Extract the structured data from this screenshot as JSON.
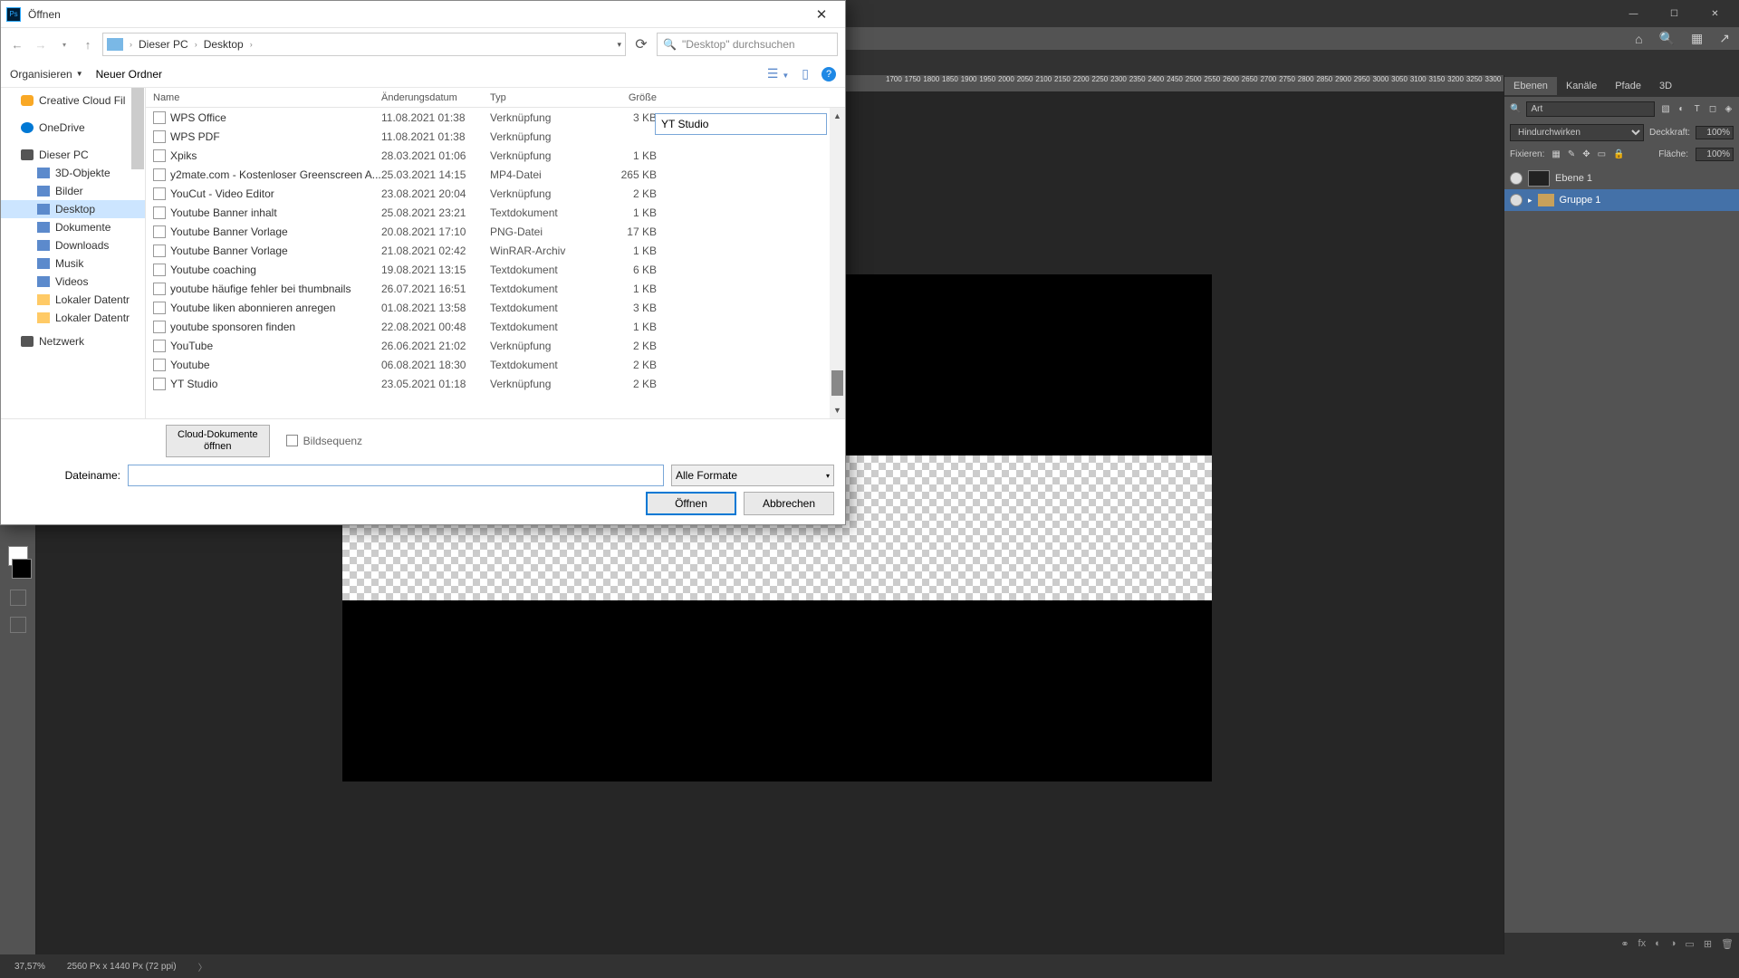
{
  "window": {
    "title": "Öffnen"
  },
  "breadcrumb": {
    "pc": "Dieser PC",
    "desktop": "Desktop"
  },
  "search": {
    "placeholder": "\"Desktop\" durchsuchen"
  },
  "toolbar": {
    "organize": "Organisieren",
    "newfolder": "Neuer Ordner"
  },
  "tree": {
    "ccfiles": "Creative Cloud Fil",
    "onedrive": "OneDrive",
    "thispc": "Dieser PC",
    "obj3d": "3D-Objekte",
    "pictures": "Bilder",
    "desktop": "Desktop",
    "documents": "Dokumente",
    "downloads": "Downloads",
    "music": "Musik",
    "videos": "Videos",
    "localdisk1": "Lokaler Datentr",
    "localdisk2": "Lokaler Datentr",
    "network": "Netzwerk"
  },
  "cols": {
    "name": "Name",
    "date": "Änderungsdatum",
    "type": "Typ",
    "size": "Größe"
  },
  "files": [
    {
      "name": "WPS Office",
      "date": "11.08.2021 01:38",
      "type": "Verknüpfung",
      "size": "3 KB"
    },
    {
      "name": "WPS PDF",
      "date": "11.08.2021 01:38",
      "type": "Verknüpfung",
      "size": ""
    },
    {
      "name": "Xpiks",
      "date": "28.03.2021 01:06",
      "type": "Verknüpfung",
      "size": "1 KB"
    },
    {
      "name": "y2mate.com - Kostenloser Greenscreen A...",
      "date": "25.03.2021 14:15",
      "type": "MP4-Datei",
      "size": "265 KB"
    },
    {
      "name": "YouCut - Video Editor",
      "date": "23.08.2021 20:04",
      "type": "Verknüpfung",
      "size": "2 KB"
    },
    {
      "name": "Youtube Banner inhalt",
      "date": "25.08.2021 23:21",
      "type": "Textdokument",
      "size": "1 KB"
    },
    {
      "name": "Youtube Banner Vorlage",
      "date": "20.08.2021 17:10",
      "type": "PNG-Datei",
      "size": "17 KB"
    },
    {
      "name": "Youtube Banner Vorlage",
      "date": "21.08.2021 02:42",
      "type": "WinRAR-Archiv",
      "size": "1 KB"
    },
    {
      "name": "Youtube coaching",
      "date": "19.08.2021 13:15",
      "type": "Textdokument",
      "size": "6 KB"
    },
    {
      "name": "youtube häufige fehler bei thumbnails",
      "date": "26.07.2021 16:51",
      "type": "Textdokument",
      "size": "1 KB"
    },
    {
      "name": "Youtube liken abonnieren anregen",
      "date": "01.08.2021 13:58",
      "type": "Textdokument",
      "size": "3 KB"
    },
    {
      "name": "youtube sponsoren finden",
      "date": "22.08.2021 00:48",
      "type": "Textdokument",
      "size": "1 KB"
    },
    {
      "name": "YouTube",
      "date": "26.06.2021 21:02",
      "type": "Verknüpfung",
      "size": "2 KB"
    },
    {
      "name": "Youtube",
      "date": "06.08.2021 18:30",
      "type": "Textdokument",
      "size": "2 KB"
    },
    {
      "name": "YT Studio",
      "date": "23.05.2021 01:18",
      "type": "Verknüpfung",
      "size": "2 KB"
    }
  ],
  "preview_value": "YT Studio",
  "cloud_btn": "Cloud-Dokumente\nöffnen",
  "bildsequenz": "Bildsequenz",
  "fn_label": "Dateiname:",
  "fmt": "Alle Formate",
  "open_btn": "Öffnen",
  "cancel_btn": "Abbrechen",
  "ps": {
    "tabs": {
      "ebenen": "Ebenen",
      "kanaele": "Kanäle",
      "pfade": "Pfade",
      "d3": "3D"
    },
    "search_ph": "Art",
    "blend": "Hindurchwirken",
    "opacity_lbl": "Deckkraft:",
    "opacity_val": "100%",
    "lock_lbl": "Fixieren:",
    "fill_lbl": "Fläche:",
    "fill_val": "100%",
    "layer1": "Ebene 1",
    "group1": "Gruppe 1",
    "zoom": "37,57%",
    "docinfo": "2560 Px x 1440 Px (72 ppi)"
  },
  "ruler": [
    "1700",
    "1750",
    "1800",
    "1850",
    "1900",
    "1950",
    "2000",
    "2050",
    "2100",
    "2150",
    "2200",
    "2250",
    "2300",
    "2350",
    "2400",
    "2450",
    "2500",
    "2550",
    "2600",
    "2650",
    "2700",
    "2750",
    "2800",
    "2850",
    "2900",
    "2950",
    "3000",
    "3050",
    "3100",
    "3150",
    "3200",
    "3250",
    "3300"
  ]
}
